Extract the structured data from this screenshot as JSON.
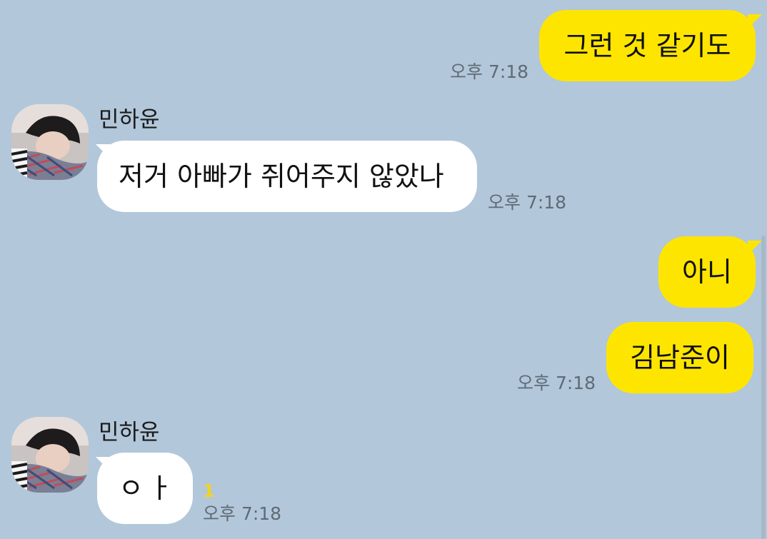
{
  "messages": {
    "m1": {
      "text": "그런 것 같기도",
      "time": "오후 7:18"
    },
    "m2": {
      "sender": "민하윤",
      "text": "저거 아빠가 쥐어주지 않았나",
      "time": "오후 7:18"
    },
    "m3": {
      "text": "아니"
    },
    "m4": {
      "text": "김남준이",
      "time": "오후 7:18"
    },
    "m5": {
      "sender": "민하윤",
      "text": "ㅇㅏ",
      "unread": "1",
      "time": "오후 7:18"
    }
  },
  "colors": {
    "background": "#b2c7da",
    "my_bubble": "#fee500",
    "other_bubble": "#ffffff",
    "time_text": "#5f6b76",
    "unread_count": "#f2d51a"
  },
  "icons": {
    "avatar": "profile-photo-icon"
  }
}
